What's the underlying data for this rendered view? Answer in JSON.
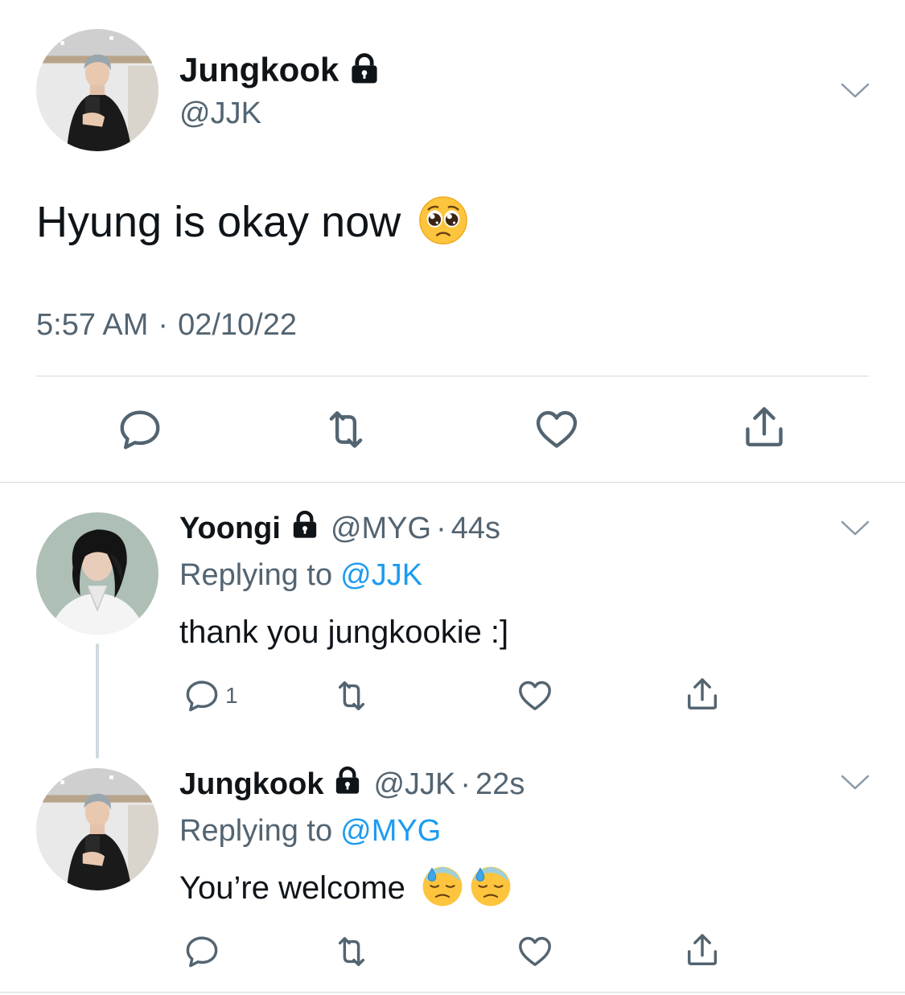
{
  "main_tweet": {
    "display_name": "Jungkook",
    "handle": "@JJK",
    "text": "Hyung is okay now",
    "emoji_icon": "pleading-face-icon",
    "time": "5:57 AM",
    "separator": "·",
    "date": "02/10/22",
    "actions": [
      "reply-icon",
      "retweet-icon",
      "like-icon",
      "share-icon"
    ]
  },
  "replies": [
    {
      "display_name": "Yoongi",
      "handle": "@MYG",
      "separator": "·",
      "age": "44s",
      "replying_prefix": "Replying to",
      "replying_to": "@JJK",
      "text": "thank you jungkookie :]",
      "reply_count": "1"
    },
    {
      "display_name": "Jungkook",
      "handle": "@JJK",
      "separator": "·",
      "age": "22s",
      "replying_prefix": "Replying to",
      "replying_to": "@MYG",
      "text": "You’re welcome",
      "emoji_icon": "downcast-face-with-sweat-icon"
    }
  ],
  "colors": {
    "text": "#0f1419",
    "secondary": "#536471",
    "link": "#1d9bf0",
    "divider": "#cfd9de"
  }
}
